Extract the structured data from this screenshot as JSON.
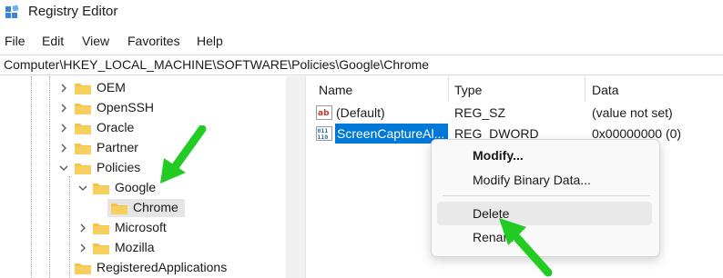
{
  "window": {
    "title": "Registry Editor"
  },
  "menu": {
    "file": "File",
    "edit": "Edit",
    "view": "View",
    "favorites": "Favorites",
    "help": "Help"
  },
  "address": {
    "path": "Computer\\HKEY_LOCAL_MACHINE\\SOFTWARE\\Policies\\Google\\Chrome"
  },
  "tree": {
    "oem": "OEM",
    "openssh": "OpenSSH",
    "oracle": "Oracle",
    "partner": "Partner",
    "policies": "Policies",
    "google": "Google",
    "chrome": "Chrome",
    "microsoft": "Microsoft",
    "mozilla": "Mozilla",
    "registered": "RegisteredApplications"
  },
  "list": {
    "headers": {
      "name": "Name",
      "type": "Type",
      "data": "Data"
    },
    "rows": [
      {
        "name": "(Default)",
        "type": "REG_SZ",
        "data": "(value not set)",
        "icon": "string-value-icon"
      },
      {
        "name": "ScreenCaptureAl...",
        "type": "REG_DWORD",
        "data": "0x00000000 (0)",
        "icon": "dword-value-icon"
      }
    ]
  },
  "context_menu": {
    "modify": "Modify...",
    "modify_binary": "Modify Binary Data...",
    "delete": "Delete",
    "rename": "Rename"
  },
  "colors": {
    "selection": "#0078d7",
    "folder": "#f4c34a",
    "arrow": "#22cc22"
  }
}
